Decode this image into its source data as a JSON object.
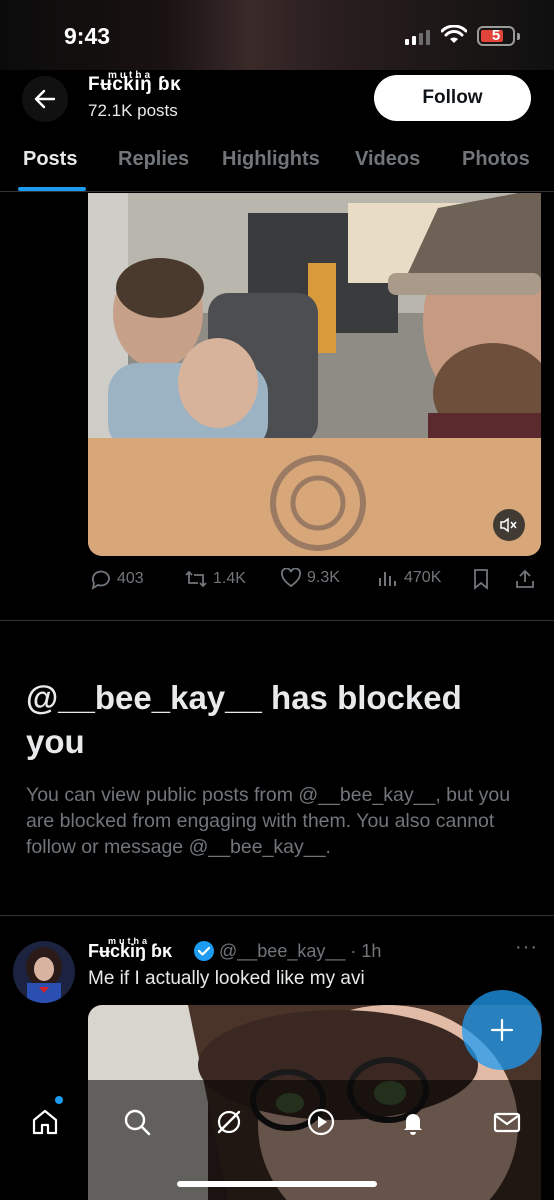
{
  "status_bar": {
    "time": "9:43",
    "battery": "5"
  },
  "header": {
    "name": "Fʉckiŋ ɓĸ",
    "name_prefix": "mutha",
    "posts": "72.1K posts",
    "follow_label": "Follow"
  },
  "tabs": [
    {
      "label": "Posts"
    },
    {
      "label": "Replies"
    },
    {
      "label": "Highlights"
    },
    {
      "label": "Videos"
    },
    {
      "label": "Photos"
    }
  ],
  "post_actions": {
    "replies": "403",
    "reposts": "1.4K",
    "likes": "9.3K",
    "views": "470K"
  },
  "blocked": {
    "title": "@__bee_kay__ has blocked you",
    "body": "You can view public posts from @__bee_kay__, but you are blocked from engaging with them. You also cannot follow or message @__bee_kay__."
  },
  "tweet": {
    "name": "Fʉckiŋ ɓĸ",
    "name_prefix": "mutha",
    "handle_time": "@__bee_kay__ · 1h",
    "text": "Me if I actually looked like my avi"
  },
  "colors": {
    "accent": "#1d9bf0",
    "muted": "#71767b",
    "text": "#e7e9ea"
  }
}
